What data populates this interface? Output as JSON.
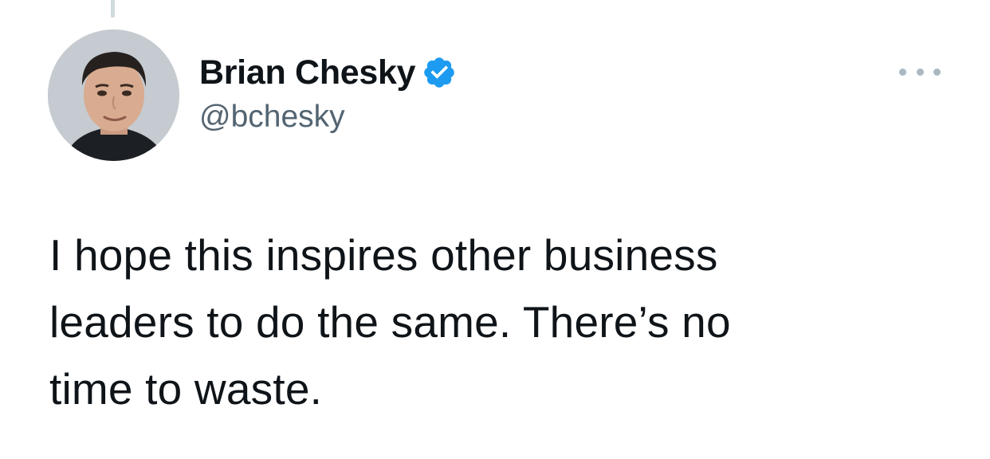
{
  "tweet": {
    "author": {
      "display_name": "Brian Chesky",
      "handle": "@bchesky",
      "verified": true,
      "verified_icon": "verified-badge-icon",
      "avatar_icon": "profile-photo"
    },
    "more_icon": "more-options-icon",
    "text": "I hope this inspires other business\nleaders to do the same. There’s no\ntime to waste."
  },
  "colors": {
    "text_primary": "#0f1419",
    "text_secondary": "#536471",
    "verified_blue": "#1d9bf0",
    "thread_line": "#cfd9de",
    "dots": "#aab8c2"
  }
}
